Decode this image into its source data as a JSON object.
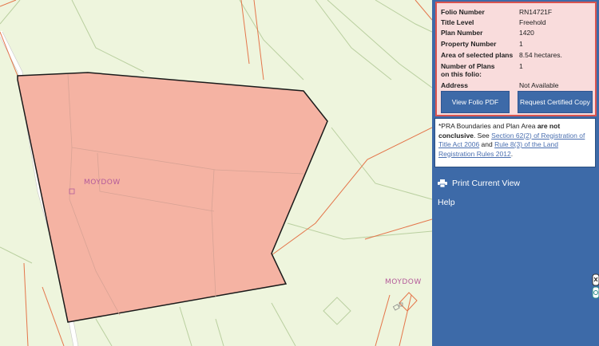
{
  "map": {
    "labels": {
      "moydow_1": "MOYDOW",
      "moydow_2": "MOYDOW"
    },
    "colors": {
      "background": "#eef5dd",
      "parcel_fill": "#f5b3a3",
      "parcel_outline": "#1a1a1a",
      "boundary": "#e4754a",
      "field_line": "#b9cf9f",
      "road": "#ffffff"
    }
  },
  "folio": {
    "rows": [
      {
        "key": "Folio Number",
        "value": "RN14721F"
      },
      {
        "key": "Title Level",
        "value": "Freehold"
      },
      {
        "key": "Plan Number",
        "value": "1420"
      },
      {
        "key": "Property Number",
        "value": "1"
      },
      {
        "key": "Area of selected plans",
        "value": "8.54 hectares."
      },
      {
        "key": "Number of Plans on this folio:",
        "value": "1"
      },
      {
        "key": "Address",
        "value": "Not Available"
      }
    ],
    "view_pdf_label": "View Folio PDF",
    "request_copy_label": "Request Certified Copy"
  },
  "notice": {
    "prefix": "*PRA Boundaries and Plan Area ",
    "bold": "are not conclusive",
    "see": ". See ",
    "link1": "Section 62(2) of Registration of Title Act 2006",
    "and": " and ",
    "link2": "Rule 8(3) of the Land Registration Rules 2012",
    "end": "."
  },
  "menu": {
    "print_label": "Print Current View",
    "help_label": "Help"
  },
  "theme": {
    "panel_blue": "#3d6aa8",
    "folio_bg": "#f9dcdc",
    "folio_border": "#d9534f",
    "link": "#4a6fb0"
  }
}
